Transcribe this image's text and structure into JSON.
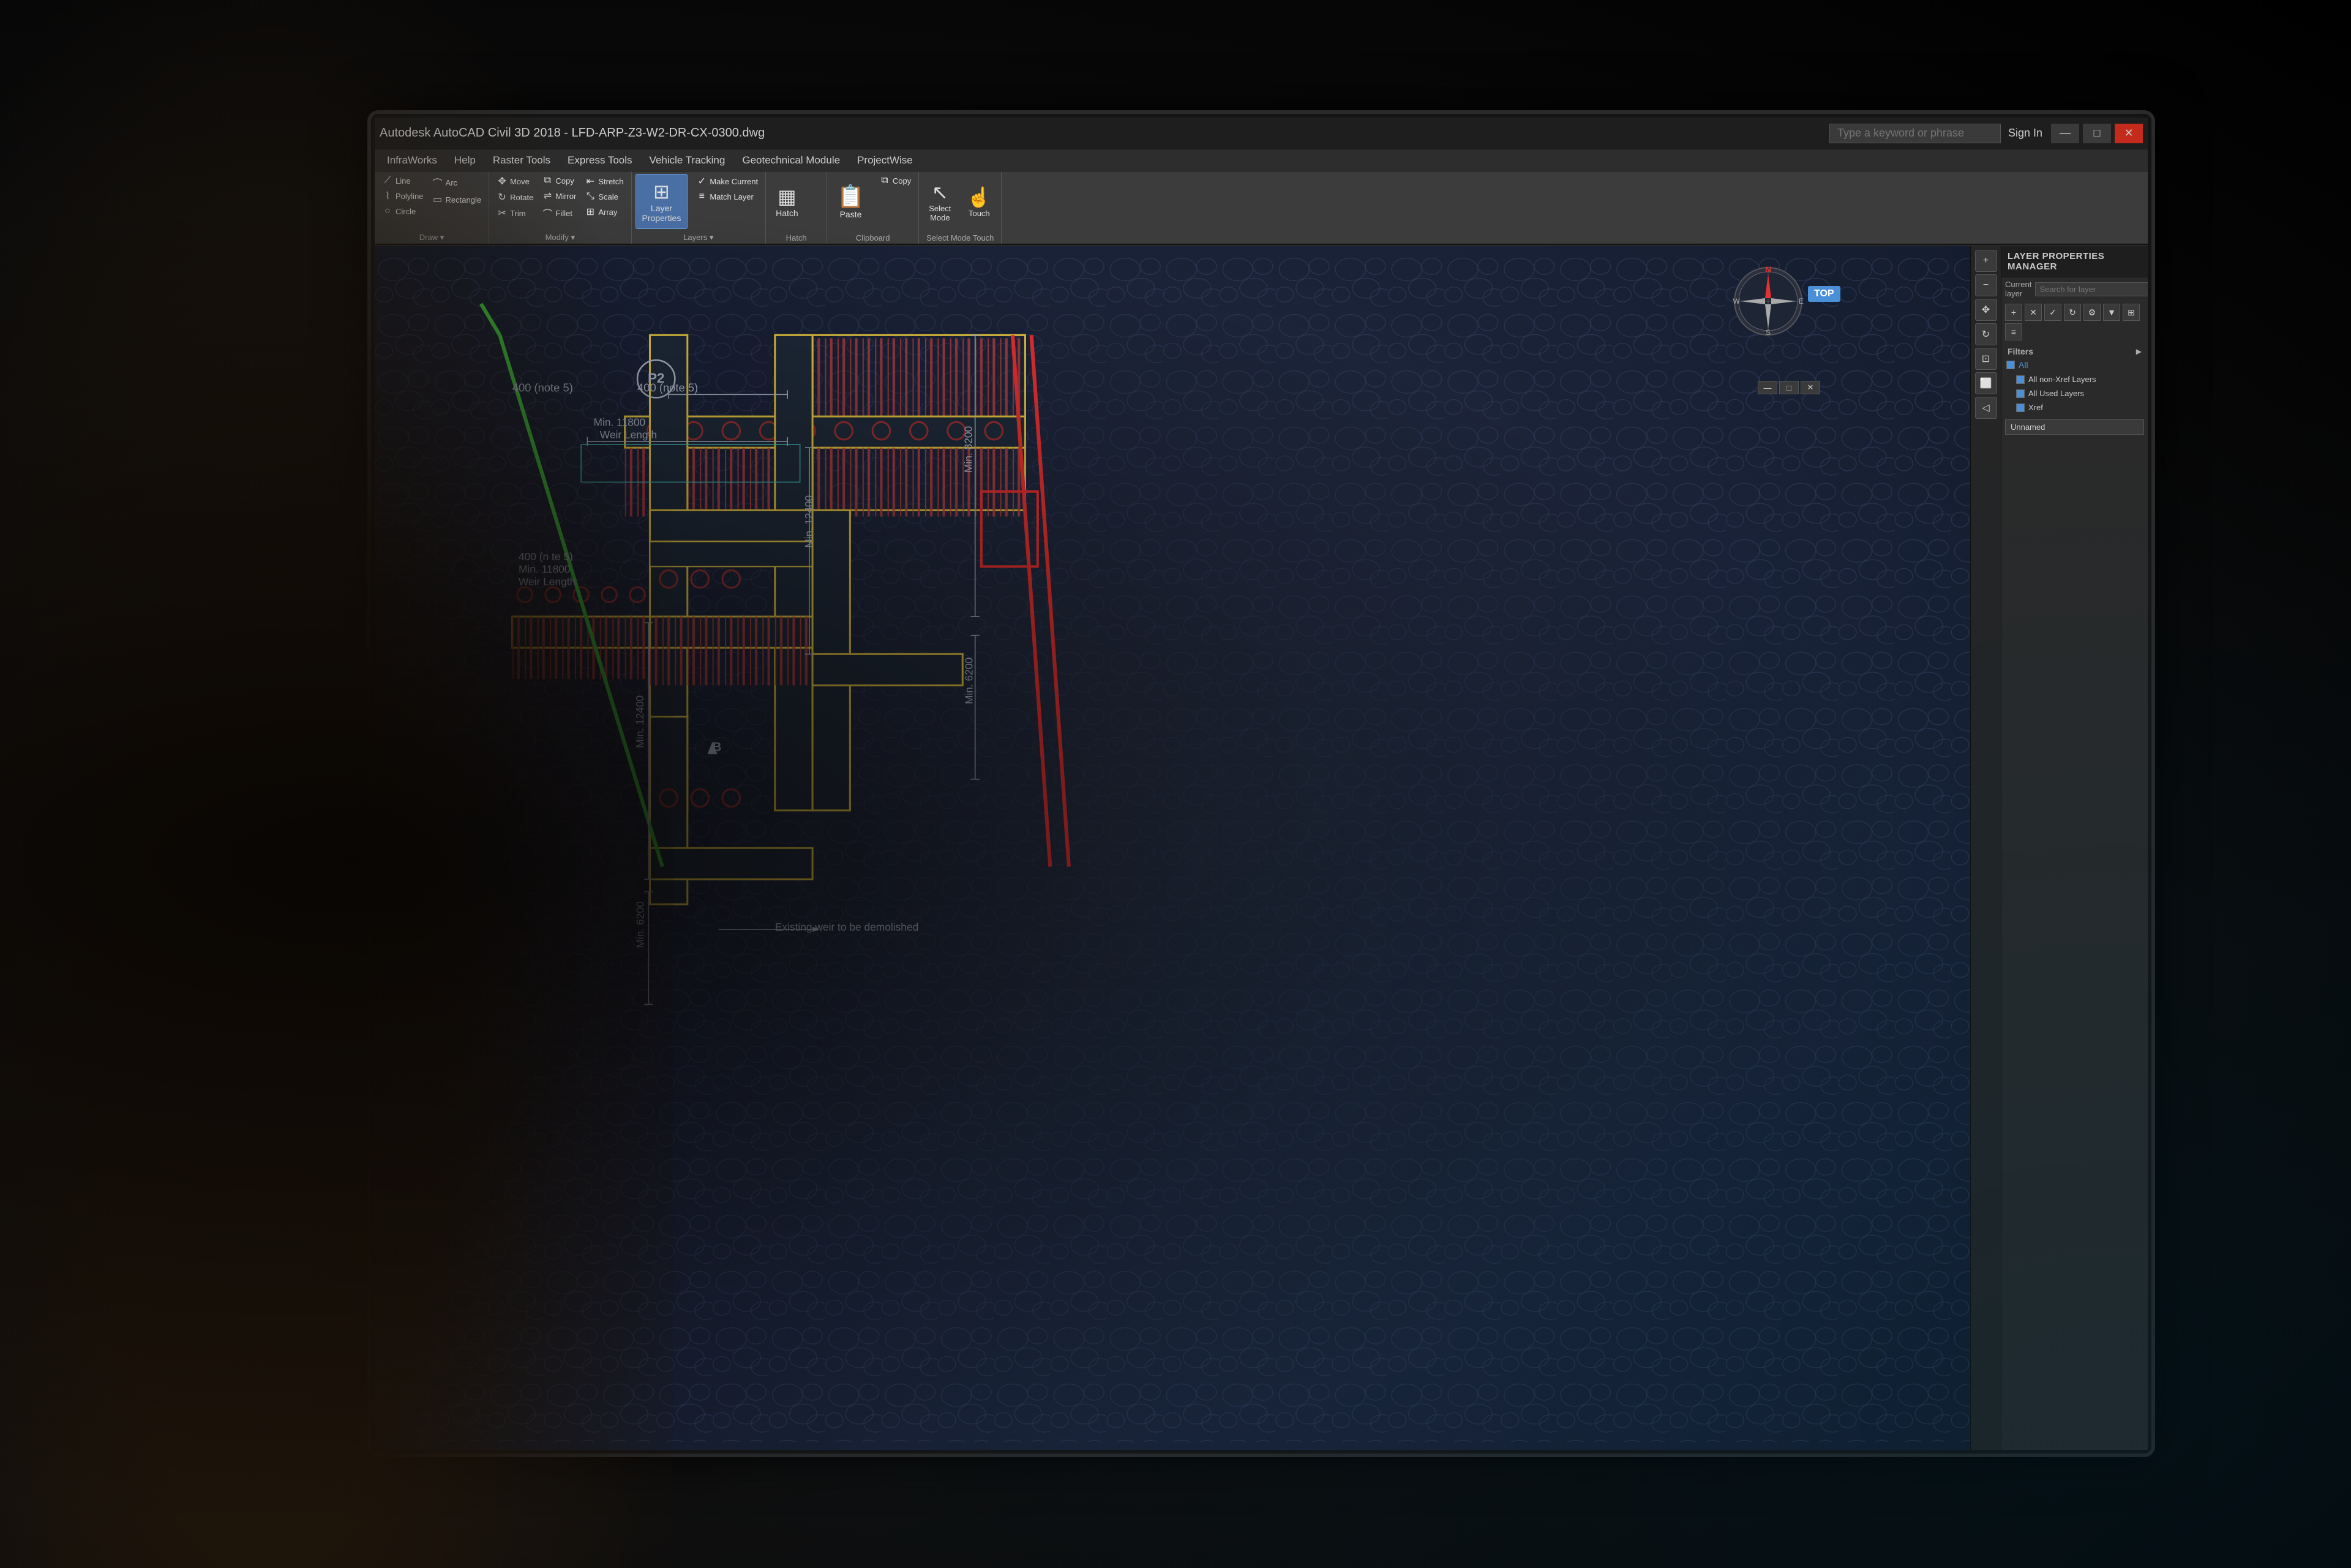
{
  "window": {
    "title": "Autodesk AutoCAD Civil 3D 2018 - LFD-ARP-Z3-W2-DR-CX-0300.dwg",
    "search_placeholder": "Type a keyword or phrase",
    "sign_in": "Sign In",
    "min_btn": "—",
    "max_btn": "□",
    "close_btn": "✕"
  },
  "menubar": {
    "items": [
      {
        "label": "InfraWorks"
      },
      {
        "label": "Help"
      },
      {
        "label": "Raster Tools"
      },
      {
        "label": "Express Tools"
      },
      {
        "label": "Vehicle Tracking"
      },
      {
        "label": "Geotechnical Module"
      },
      {
        "label": "ProjectWise"
      }
    ]
  },
  "ribbon": {
    "groups": [
      {
        "id": "draw",
        "label": "Draw",
        "buttons": [
          {
            "id": "line",
            "icon": "✏",
            "label": ""
          },
          {
            "id": "polyline",
            "icon": "⟋",
            "label": ""
          },
          {
            "id": "circle",
            "icon": "○",
            "label": ""
          }
        ]
      },
      {
        "id": "modify",
        "label": "Modify",
        "buttons": [
          {
            "id": "move",
            "icon": "↔",
            "label": "Move"
          },
          {
            "id": "rotate",
            "icon": "↻",
            "label": "Rotate"
          },
          {
            "id": "trim",
            "icon": "✂",
            "label": "Trim"
          },
          {
            "id": "copy",
            "icon": "⧉",
            "label": "Copy"
          },
          {
            "id": "mirror",
            "icon": "⇌",
            "label": "Mirror"
          },
          {
            "id": "fillet",
            "icon": "⌒",
            "label": "Fillet"
          },
          {
            "id": "stretch",
            "icon": "⇤",
            "label": "Stretch"
          },
          {
            "id": "scale",
            "icon": "⤡",
            "label": "Scale"
          },
          {
            "id": "array",
            "icon": "⊞",
            "label": "Array"
          }
        ]
      },
      {
        "id": "layers",
        "label": "Layers",
        "buttons": [
          {
            "id": "layer-properties",
            "icon": "⊞",
            "label": "Layer\nProperties",
            "active": true
          },
          {
            "id": "make-current",
            "icon": "✓",
            "label": "Make Current"
          },
          {
            "id": "match-layer",
            "icon": "≡",
            "label": "Match Layer"
          }
        ]
      },
      {
        "id": "hatch",
        "label": "Hatch",
        "buttons": [
          {
            "id": "hatch-btn",
            "icon": "▦",
            "label": "Hatch"
          }
        ]
      },
      {
        "id": "clipboard",
        "label": "Clipboard",
        "buttons": [
          {
            "id": "paste",
            "icon": "📋",
            "label": "Paste"
          },
          {
            "id": "copy-clip",
            "icon": "⧉",
            "label": "Copy"
          }
        ]
      },
      {
        "id": "select",
        "label": "Select Mode Touch",
        "buttons": [
          {
            "id": "select-mode",
            "icon": "↖",
            "label": "Select\nMode"
          },
          {
            "id": "touch",
            "icon": "☝",
            "label": "Touch"
          }
        ]
      }
    ]
  },
  "cad": {
    "drawing_name": "LFD-ARP-Z3-W2-DR-CX-0300.dwg",
    "annotations": [
      "400 (note 5)",
      "400 (note 5)",
      "400 (n te 5)",
      "Min. 11800",
      "Weir Length",
      "Min. 11800",
      "Weir Length",
      "Min. 12400",
      "Min. 12400",
      "Min. 8200",
      "Min. 6200",
      "Min. 6200",
      "B",
      "P2",
      "Existing weir to be demolished"
    ],
    "compass": {
      "direction": "N",
      "label": "TOP"
    }
  },
  "layer_panel": {
    "title": "LAYER PROPERTIES MANAGER",
    "current_layer_label": "Current layer",
    "search_placeholder": "Search for layer",
    "filters_label": "Filters",
    "all_label": "All",
    "layers": [
      {
        "id": "all-non-xref",
        "label": "All non-Xref Layers",
        "checked": true
      },
      {
        "id": "all-used",
        "label": "All Used Layers",
        "checked": true
      },
      {
        "id": "xref",
        "label": "Xref",
        "checked": true
      }
    ],
    "unnamed_label": "Unnamed"
  },
  "colors": {
    "accent_blue": "#4a90d9",
    "cad_bg": "#1e2535",
    "cad_lines_yellow": "#e8c840",
    "cad_lines_red": "#e83030",
    "cad_lines_green": "#40c840",
    "cad_lines_white": "#b0b8c8",
    "cad_hatch_red": "#c04040",
    "ribbon_bg": "#3c3c3c",
    "panel_bg": "#2a2a2a",
    "titlebar_bg": "#1e1e1e"
  }
}
